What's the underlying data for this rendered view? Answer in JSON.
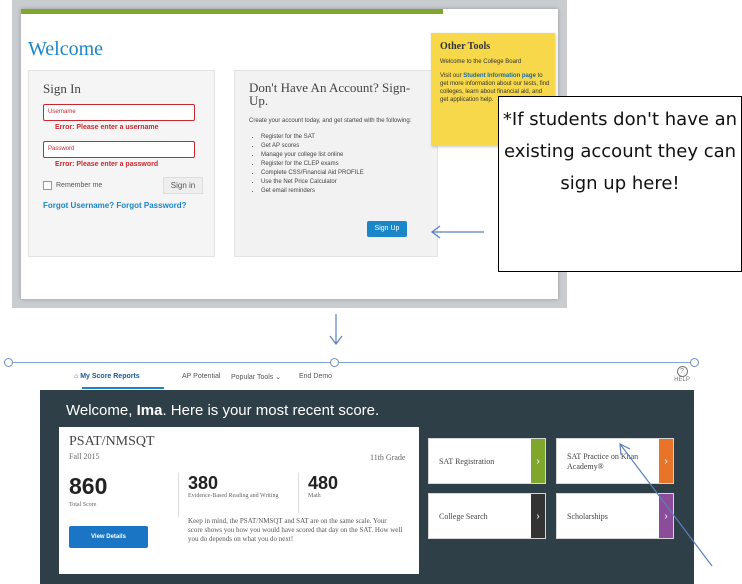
{
  "login_page": {
    "welcome": "Welcome",
    "sign_in": {
      "title": "Sign In",
      "username_placeholder": "Username",
      "username_error": "Error: Please enter a username",
      "password_placeholder": "Password",
      "password_error": "Error: Please enter a password",
      "remember_me": "Remember me",
      "sign_in_button": "Sign in",
      "forgot": "Forgot Username? Forgot Password?"
    },
    "sign_up": {
      "title": "Don't Have An Account? Sign-Up.",
      "intro": "Create your account today, and get started with the following:",
      "items": [
        "Register for the SAT",
        "Get AP scores",
        "Manage your college list online",
        "Register for the CLEP exams",
        "Complete CSS/Financial Aid PROFILE",
        "Use the Net Price Calculator",
        "Get email reminders"
      ],
      "button": "Sign Up"
    },
    "other_tools": {
      "title": "Other Tools",
      "text1": "Welcome to the College Board",
      "text2_prefix": "Visit our ",
      "text2_link": "Student Information page",
      "text2_suffix": " to get more information about our tests, find colleges, learn about financial aid, and get application help."
    }
  },
  "callout": {
    "text": "*If students don't have an existing account they can sign up here!"
  },
  "score_dashboard": {
    "nav": {
      "items": [
        "My Score Reports",
        "AP Potential",
        "Popular Tools",
        "End Demo"
      ],
      "help": "HELP"
    },
    "welcome_prefix": "Welcome, ",
    "welcome_name": "Ima",
    "welcome_suffix": ". Here is your most recent score.",
    "exam": "PSAT/NMSQT",
    "term": "Fall 2015",
    "grade": "11th Grade",
    "total_score": "860",
    "total_label": "Total Score",
    "ebrw_score": "380",
    "ebrw_label": "Evidence-Based Reading and Writing",
    "math_score": "480",
    "math_label": "Math",
    "note": "Keep in mind, the PSAT/NMSQT and SAT are on the same scale. Your score shows you how you would have scored that day on the SAT. How well you do depends on what you do next!",
    "view_details": "View Details",
    "tiles": [
      {
        "label": "SAT Registration",
        "color": "#7ea72c"
      },
      {
        "label": "SAT Practice on Khan Academy®",
        "color": "#e8742a"
      },
      {
        "label": "College Search",
        "color": "#333333"
      },
      {
        "label": "Scholarships",
        "color": "#8b4d9a"
      }
    ]
  }
}
